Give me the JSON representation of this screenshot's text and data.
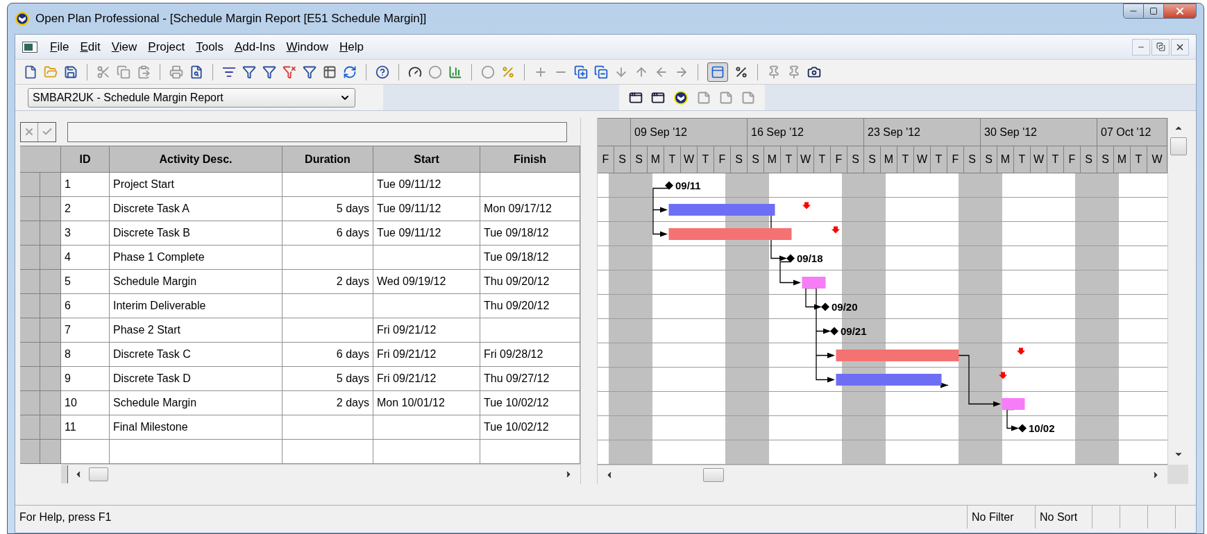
{
  "window": {
    "title": "Open Plan Professional - [Schedule Margin Report [E51 Schedule Margin]]"
  },
  "menu": [
    {
      "label": "File"
    },
    {
      "label": "Edit"
    },
    {
      "label": "View"
    },
    {
      "label": "Project"
    },
    {
      "label": "Tools"
    },
    {
      "label": "Add-Ins"
    },
    {
      "label": "Window"
    },
    {
      "label": "Help"
    }
  ],
  "toolbar_toggle": {
    "selected": true
  },
  "layout_selector": {
    "value": "SMBAR2UK - Schedule Margin Report"
  },
  "table": {
    "columns": [
      "ID",
      "Activity Desc.",
      "Duration",
      "Start",
      "Finish"
    ],
    "rows": [
      {
        "id": "1",
        "activity": "Project Start",
        "start": "Tue 09/11/12"
      },
      {
        "id": "2",
        "activity": "Discrete Task A",
        "duration": "5 days",
        "start": "Tue 09/11/12",
        "finish": "Mon 09/17/12"
      },
      {
        "id": "3",
        "activity": "Discrete Task B",
        "duration": "6 days",
        "start": "Tue 09/11/12",
        "finish": "Tue 09/18/12"
      },
      {
        "id": "4",
        "activity": "Phase 1 Complete",
        "finish": "Tue 09/18/12"
      },
      {
        "id": "5",
        "activity": "Schedule Margin",
        "duration": "2 days",
        "start": "Wed 09/19/12",
        "finish": "Thu 09/20/12"
      },
      {
        "id": "6",
        "activity": "Interim Deliverable",
        "finish": "Thu 09/20/12"
      },
      {
        "id": "7",
        "activity": "Phase 2 Start",
        "start": "Fri 09/21/12"
      },
      {
        "id": "8",
        "activity": "Discrete Task C",
        "duration": "6 days",
        "start": "Fri 09/21/12",
        "finish": "Fri 09/28/12"
      },
      {
        "id": "9",
        "activity": "Discrete Task D",
        "duration": "5 days",
        "start": "Fri 09/21/12",
        "finish": "Thu 09/27/12"
      },
      {
        "id": "10",
        "activity": "Schedule Margin",
        "duration": "2 days",
        "start": "Mon 10/01/12",
        "finish": "Tue 10/02/12"
      },
      {
        "id": "11",
        "activity": "Final Milestone",
        "finish": "Tue 10/02/12"
      }
    ]
  },
  "gantt": {
    "weeks": [
      "09 Sep '12",
      "16 Sep '12",
      "23 Sep '12",
      "30 Sep '12",
      "07 Oct '12"
    ],
    "days": [
      "F",
      "S",
      "S",
      "M",
      "T",
      "W",
      "T",
      "F",
      "S",
      "S",
      "M",
      "T",
      "W",
      "T",
      "F",
      "S",
      "S",
      "M",
      "T",
      "W",
      "T",
      "F",
      "S",
      "S",
      "M",
      "T",
      "W",
      "T",
      "F",
      "S",
      "S",
      "M",
      "T",
      "W"
    ],
    "bars": [
      {
        "kind": "milestone",
        "label": "09/11"
      },
      {
        "kind": "task",
        "color": "#6e6ef5"
      },
      {
        "kind": "task",
        "color": "#f57272"
      },
      {
        "kind": "milestone",
        "label": "09/18"
      },
      {
        "kind": "task",
        "color": "#f77cf7"
      },
      {
        "kind": "milestone",
        "label": "09/20"
      },
      {
        "kind": "milestone",
        "label": "09/21"
      },
      {
        "kind": "task",
        "color": "#f57272"
      },
      {
        "kind": "task",
        "color": "#6e6ef5"
      },
      {
        "kind": "task",
        "color": "#f77cf7"
      },
      {
        "kind": "milestone",
        "label": "10/02"
      }
    ]
  },
  "status_bar": {
    "message": "For Help, press F1",
    "filter": "No Filter",
    "sort": "No Sort"
  }
}
